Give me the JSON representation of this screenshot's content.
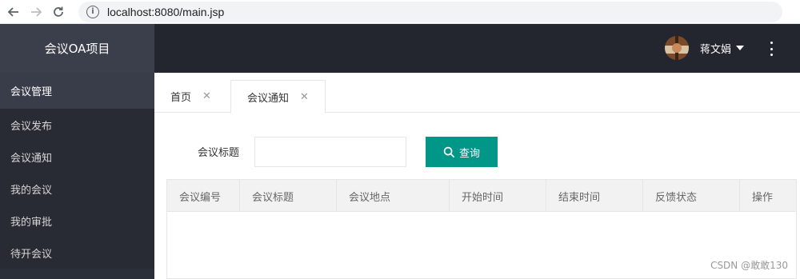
{
  "browser": {
    "url": "localhost:8080/main.jsp"
  },
  "sidebar": {
    "logo": "会议OA项目",
    "group": "会议管理",
    "items": [
      {
        "label": "会议发布"
      },
      {
        "label": "会议通知"
      },
      {
        "label": "我的会议"
      },
      {
        "label": "我的审批"
      },
      {
        "label": "待开会议"
      }
    ]
  },
  "topbar": {
    "username": "蒋文娟"
  },
  "tabs": [
    {
      "label": "首页"
    },
    {
      "label": "会议通知"
    }
  ],
  "search": {
    "label": "会议标题",
    "value": "",
    "button_label": "查询"
  },
  "table": {
    "columns": [
      "会议编号",
      "会议标题",
      "会议地点",
      "开始时间",
      "结束时间",
      "反馈状态",
      "操作"
    ]
  },
  "watermark": "CSDN @敢敢130",
  "colors": {
    "sidebar_bg": "#2b2f3a",
    "topbar_bg": "#23262e",
    "primary": "#009688"
  }
}
